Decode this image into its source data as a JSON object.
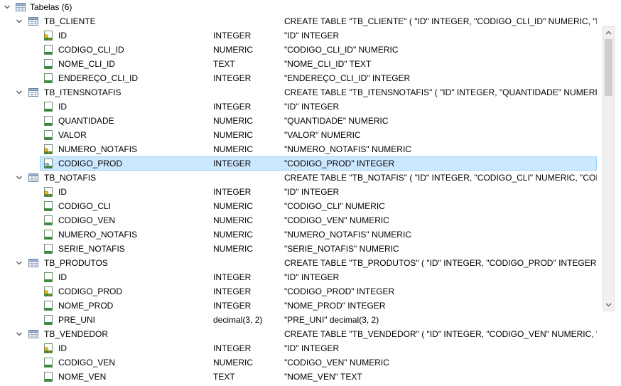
{
  "root": {
    "label": "Tabelas (6)"
  },
  "tables": [
    {
      "name": "TB_CLIENTE",
      "schema": "CREATE TABLE \"TB_CLIENTE\" ( \"ID\" INTEGER, \"CODIGO_CLI_ID\" NUMERIC, \"N",
      "columns": [
        {
          "name": "ID",
          "type": "INTEGER",
          "schema": "\"ID\" INTEGER",
          "icon": "primary-key-column-icon"
        },
        {
          "name": "CODIGO_CLI_ID",
          "type": "NUMERIC",
          "schema": "\"CODIGO_CLI_ID\" NUMERIC",
          "icon": "column-icon"
        },
        {
          "name": "NOME_CLI_ID",
          "type": "TEXT",
          "schema": "\"NOME_CLI_ID\" TEXT",
          "icon": "column-icon"
        },
        {
          "name": "ENDEREÇO_CLI_ID",
          "type": "INTEGER",
          "schema": "\"ENDEREÇO_CLI_ID\" INTEGER",
          "icon": "column-icon"
        }
      ]
    },
    {
      "name": "TB_ITENSNOTAFIS",
      "schema": "CREATE TABLE \"TB_ITENSNOTAFIS\" ( \"ID\" INTEGER, \"QUANTIDADE\" NUMERI",
      "columns": [
        {
          "name": "ID",
          "type": "INTEGER",
          "schema": "\"ID\" INTEGER",
          "icon": "column-icon"
        },
        {
          "name": "QUANTIDADE",
          "type": "NUMERIC",
          "schema": "\"QUANTIDADE\" NUMERIC",
          "icon": "column-icon"
        },
        {
          "name": "VALOR",
          "type": "NUMERIC",
          "schema": "\"VALOR\" NUMERIC",
          "icon": "column-icon"
        },
        {
          "name": "NUMERO_NOTAFIS",
          "type": "NUMERIC",
          "schema": "\"NUMERO_NOTAFIS\" NUMERIC",
          "icon": "primary-key-column-icon"
        },
        {
          "name": "CODIGO_PROD",
          "type": "INTEGER",
          "schema": "\"CODIGO_PROD\" INTEGER",
          "icon": "foreign-key-column-icon",
          "selected": true
        }
      ]
    },
    {
      "name": "TB_NOTAFIS",
      "schema": "CREATE TABLE \"TB_NOTAFIS\" ( \"ID\" INTEGER, \"CODIGO_CLI\" NUMERIC, \"COI",
      "columns": [
        {
          "name": "ID",
          "type": "INTEGER",
          "schema": "\"ID\" INTEGER",
          "icon": "primary-key-column-icon"
        },
        {
          "name": "CODIGO_CLI",
          "type": "NUMERIC",
          "schema": "\"CODIGO_CLI\" NUMERIC",
          "icon": "column-icon"
        },
        {
          "name": "CODIGO_VEN",
          "type": "NUMERIC",
          "schema": "\"CODIGO_VEN\" NUMERIC",
          "icon": "column-icon"
        },
        {
          "name": "NUMERO_NOTAFIS",
          "type": "NUMERIC",
          "schema": "\"NUMERO_NOTAFIS\" NUMERIC",
          "icon": "column-icon"
        },
        {
          "name": "SERIE_NOTAFIS",
          "type": "NUMERIC",
          "schema": "\"SERIE_NOTAFIS\" NUMERIC",
          "icon": "column-icon"
        }
      ]
    },
    {
      "name": "TB_PRODUTOS",
      "schema": "CREATE TABLE \"TB_PRODUTOS\" ( \"ID\" INTEGER, \"CODIGO_PROD\" INTEGER,",
      "columns": [
        {
          "name": "ID",
          "type": "INTEGER",
          "schema": "\"ID\" INTEGER",
          "icon": "column-icon"
        },
        {
          "name": "CODIGO_PROD",
          "type": "INTEGER",
          "schema": "\"CODIGO_PROD\" INTEGER",
          "icon": "primary-key-column-icon"
        },
        {
          "name": "NOME_PROD",
          "type": "INTEGER",
          "schema": "\"NOME_PROD\" INTEGER",
          "icon": "column-icon"
        },
        {
          "name": "PRE_UNI",
          "type": "decimal(3, 2)",
          "schema": "\"PRE_UNI\" decimal(3, 2)",
          "icon": "column-icon"
        }
      ]
    },
    {
      "name": "TB_VENDEDOR",
      "schema": "CREATE TABLE \"TB_VENDEDOR\" ( \"ID\" INTEGER, \"CODIGO_VEN\" NUMERIC, \"N",
      "columns": [
        {
          "name": "ID",
          "type": "INTEGER",
          "schema": "\"ID\" INTEGER",
          "icon": "primary-key-column-icon"
        },
        {
          "name": "CODIGO_VEN",
          "type": "NUMERIC",
          "schema": "\"CODIGO_VEN\" NUMERIC",
          "icon": "column-icon"
        },
        {
          "name": "NOME_VEN",
          "type": "TEXT",
          "schema": "\"NOME_VEN\" TEXT",
          "icon": "column-icon"
        }
      ]
    }
  ],
  "colors": {
    "selection_bg": "#cce8ff",
    "selection_border": "#99d1ff",
    "column_icon_green": "#3a8a3a",
    "key_icon_gold": "#d9a21b"
  }
}
